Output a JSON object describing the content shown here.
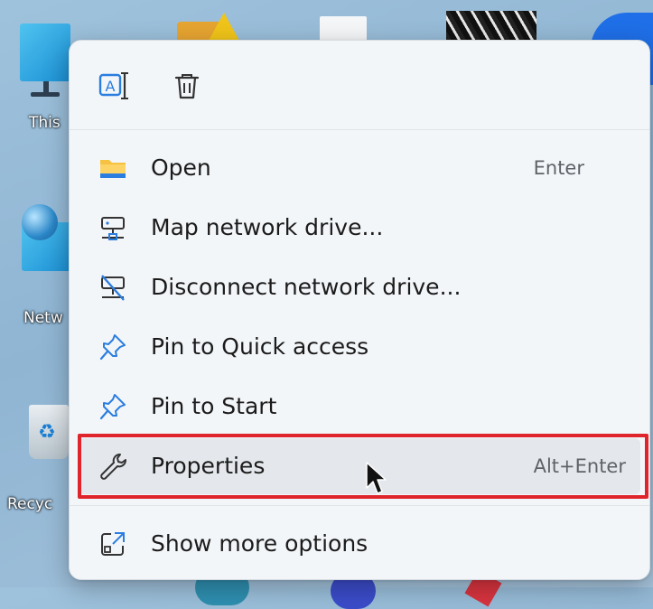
{
  "desktop": {
    "icons": [
      {
        "label": "This"
      },
      {
        "label": "Netw"
      },
      {
        "label": "Recyc"
      }
    ]
  },
  "context_menu": {
    "quick_actions": [
      {
        "name": "rename",
        "icon": "rename-icon"
      },
      {
        "name": "delete",
        "icon": "trash-icon"
      }
    ],
    "items": [
      {
        "label": "Open",
        "shortcut": "Enter",
        "icon": "folder-icon"
      },
      {
        "label": "Map network drive...",
        "shortcut": "",
        "icon": "map-network-drive-icon"
      },
      {
        "label": "Disconnect network drive...",
        "shortcut": "",
        "icon": "disconnect-network-drive-icon"
      },
      {
        "label": "Pin to Quick access",
        "shortcut": "",
        "icon": "pin-icon"
      },
      {
        "label": "Pin to Start",
        "shortcut": "",
        "icon": "pin-icon"
      },
      {
        "label": "Properties",
        "shortcut": "Alt+Enter",
        "icon": "wrench-icon"
      },
      {
        "label": "Show more options",
        "shortcut": "",
        "icon": "open-external-icon"
      }
    ],
    "highlighted_item": "Properties"
  },
  "colors": {
    "highlight_frame": "#e0242b",
    "accent_blue": "#2b7de0",
    "folder_yellow": "#f5c242"
  }
}
